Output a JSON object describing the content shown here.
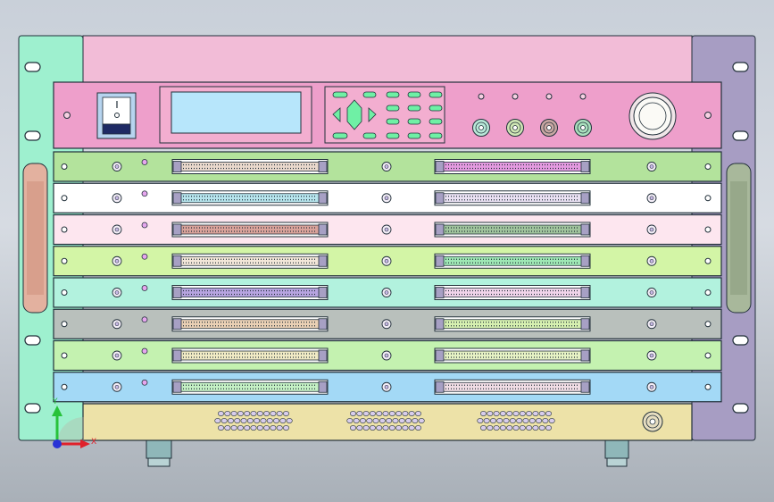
{
  "colors": {
    "background_top": "#c9d0d9",
    "background_bottom": "#a9b0b8",
    "left_ear": "#9ef0cf",
    "right_ear": "#a79dc3",
    "top_panel": "#f2bcd7",
    "control_panel": "#ee9fcb",
    "lcd": "#b7e6fb",
    "base_panel": "#ede2a8",
    "left_handle": "#e3b19f",
    "right_handle": "#a8b89b",
    "outline": "#22303a",
    "axis_x": "#e0202a",
    "axis_y": "#27c23a",
    "axis_z": "#2a33d6"
  },
  "control_panel": {
    "power_switch_icon": "rocker-switch-icon",
    "display": "lcd-display",
    "keypad_rows": 4,
    "bnc_connectors": [
      {
        "name": "bnc-connector-1",
        "color": "#b8e8d8"
      },
      {
        "name": "bnc-connector-2",
        "color": "#cfe6b4"
      },
      {
        "name": "bnc-connector-3",
        "color": "#c9a7a2"
      },
      {
        "name": "bnc-connector-4",
        "color": "#a9e0bd"
      }
    ],
    "emergency_button_icon": "round-knob-icon"
  },
  "modules": [
    {
      "panel": "#b3e39c",
      "left_connector": "#e9d8cc",
      "right_connector": "#e49ae0"
    },
    {
      "panel": "#ffffff",
      "left_connector": "#b6e4ec",
      "right_connector": "#e9e0f2"
    },
    {
      "panel": "#fde6ef",
      "left_connector": "#d9a29a",
      "right_connector": "#9fc39c"
    },
    {
      "panel": "#d3f5a6",
      "left_connector": "#f2e6d8",
      "right_connector": "#9ee7b4"
    },
    {
      "panel": "#b2f2de",
      "left_connector": "#b7a4e0",
      "right_connector": "#f0d4ea"
    },
    {
      "panel": "#b9c0bc",
      "left_connector": "#ead0b4",
      "right_connector": "#d6f0b0"
    },
    {
      "panel": "#c4f2b0",
      "left_connector": "#f0eac4",
      "right_connector": "#e6f2c4"
    },
    {
      "panel": "#a3d9f6",
      "left_connector": "#c4f0c4",
      "right_connector": "#f0dce4"
    }
  ],
  "base": {
    "vent_groups": 3,
    "connector_icon": "round-connector-icon"
  },
  "triad": {
    "x_label": "X",
    "y_label": "Y"
  }
}
